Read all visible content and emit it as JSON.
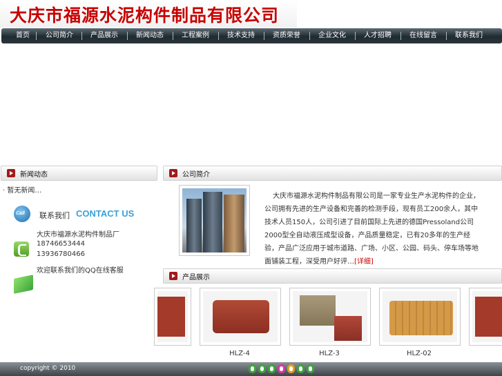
{
  "header": {
    "logo_text": "大庆市福源水泥构件制品有限公司"
  },
  "nav": {
    "items": [
      "首页",
      "公司简介",
      "产品展示",
      "新闻动态",
      "工程案例",
      "技术支持",
      "资质荣誉",
      "企业文化",
      "人才招聘",
      "在线留言",
      "联系我们"
    ]
  },
  "left": {
    "section_title": "新闻动态",
    "news_item": "· 暂无新闻…",
    "contact": {
      "label": "联系我们",
      "label_en": "CONTACT US",
      "company": "大庆市福源水泥构件制品厂",
      "phone1": "18746653444",
      "phone2": "13936780466",
      "qq_text": "欢迎联系我们的QQ在线客服"
    }
  },
  "about": {
    "section_title": "公司简介",
    "text": "大庆市福源水泥构件制品有限公司是一家专业生产水泥构件的企业，公司拥有先进的生产设备和完善的检测手段，现有员工200余人，其中技术人员150人，公司引进了目前国际上先进的德国Pressoland公司2000型全自动液压成型设备，产品质量稳定，已有20多年的生产经验，产品广泛应用于城市道路、广场、小区、公园、码头、停车场等地面铺装工程，深受用户好评…",
    "more_link": "[详细]"
  },
  "products": {
    "section_title": "产品展示",
    "items": [
      {
        "caption": "HLZ-4",
        "color": "#a33a2a"
      },
      {
        "caption": "HLZ-3",
        "color": "#9a8b6c"
      },
      {
        "caption": "HLZ-02",
        "color": "#c98b3a"
      }
    ]
  },
  "footer": {
    "copyright": "copyright © 2010",
    "counter": "0005208",
    "counter_colors": [
      "#3aa53a",
      "#3aa53a",
      "#3aa53a",
      "#3aa53a",
      "#d43aa0",
      "#e0a020",
      "#3aa53a"
    ]
  },
  "colors": {
    "accent": "#a21a1a",
    "link": "#cc0000"
  }
}
